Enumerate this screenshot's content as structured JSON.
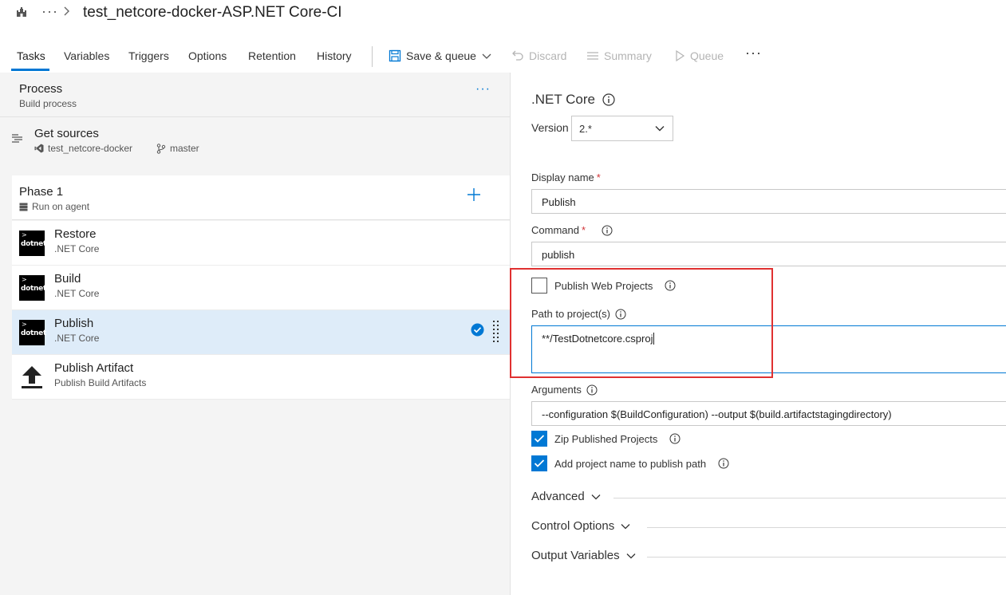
{
  "window": {
    "title": "test_netcore-docker-ASP.NET Core-CI",
    "breadcrumb_more": "···",
    "icon": "castle-icon"
  },
  "tabs": [
    {
      "label": "Tasks",
      "active": true
    },
    {
      "label": "Variables"
    },
    {
      "label": "Triggers"
    },
    {
      "label": "Options"
    },
    {
      "label": "Retention"
    },
    {
      "label": "History"
    }
  ],
  "toolbar": {
    "save_queue": "Save & queue",
    "discard": "Discard",
    "summary": "Summary",
    "queue": "Queue",
    "more": "···"
  },
  "left": {
    "process": {
      "title": "Process",
      "subtitle": "Build process",
      "more": "···"
    },
    "get_sources": {
      "title": "Get sources",
      "repo": "test_netcore-docker",
      "branch": "master"
    },
    "phase": {
      "title": "Phase 1",
      "subtitle": "Run on agent"
    },
    "tasks": [
      {
        "title": "Restore",
        "subtitle": ".NET Core",
        "icon_label": "dotnet"
      },
      {
        "title": "Build",
        "subtitle": ".NET Core",
        "icon_label": "dotnet"
      },
      {
        "title": "Publish",
        "subtitle": ".NET Core",
        "icon_label": "dotnet",
        "selected": true
      },
      {
        "title": "Publish Artifact",
        "subtitle": "Publish Build Artifacts"
      }
    ]
  },
  "right": {
    "section_title": ".NET Core",
    "version_label": "Version",
    "version_value": "2.*",
    "display_name_label": "Display name",
    "display_name_value": "Publish",
    "command_label": "Command",
    "command_value": "publish",
    "required_mark": "*",
    "publish_web_projects_label": "Publish Web Projects",
    "publish_web_projects_checked": false,
    "path_label": "Path to project(s)",
    "path_value": "**/TestDotnetcore.csproj",
    "arguments_label": "Arguments",
    "arguments_value": "--configuration $(BuildConfiguration) --output $(build.artifactstagingdirectory)",
    "zip_label": "Zip Published Projects",
    "zip_checked": true,
    "add_project_label": "Add project name to publish path",
    "add_project_checked": true,
    "advanced": "Advanced",
    "control_options": "Control Options",
    "output_variables": "Output Variables"
  },
  "colors": {
    "accent": "#0078d4",
    "selected_row": "#deecf9",
    "highlight_box": "#e03131",
    "required": "#d13438"
  }
}
